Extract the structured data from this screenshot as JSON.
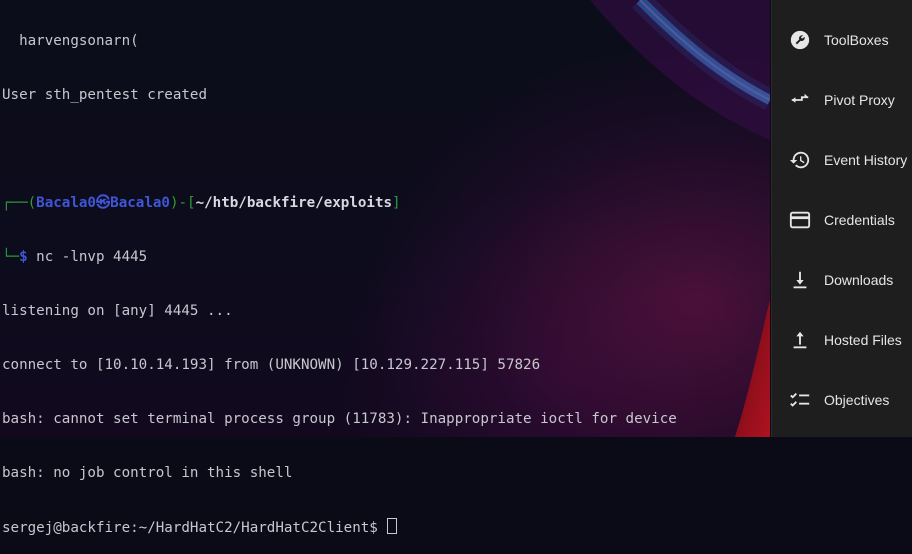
{
  "terminal": {
    "lines": [
      {
        "text": "  harvengsonarn("
      },
      {
        "text": "User sth_pentest created"
      },
      {
        "text": ""
      },
      {
        "prompt_open": "┌──(",
        "user": "Bacala0㉿Bacala0",
        "prompt_mid": ")-[",
        "path": "~/htb/backfire/exploits",
        "prompt_close": "]"
      },
      {
        "prompt_open": "└─",
        "dollar": "$",
        "command": " nc -lnvp 4445"
      },
      {
        "text": "listening on [any] 4445 ..."
      },
      {
        "text": "connect to [10.10.14.193] from (UNKNOWN) [10.129.227.115] 57826"
      },
      {
        "text": "bash: cannot set terminal process group (11783): Inappropriate ioctl for device"
      },
      {
        "text": "bash: no job control in this shell"
      },
      {
        "text": "sergej@backfire:~/HardHatC2/HardHatC2Client$ "
      }
    ]
  },
  "sidebar": {
    "items": [
      {
        "label": "ToolBoxes",
        "icon": "wrench-icon"
      },
      {
        "label": "Pivot Proxy",
        "icon": "pivot-arrows-icon"
      },
      {
        "label": "Event History",
        "icon": "history-icon"
      },
      {
        "label": "Credentials",
        "icon": "credit-card-icon"
      },
      {
        "label": "Downloads",
        "icon": "download-icon"
      },
      {
        "label": "Hosted Files",
        "icon": "upload-icon"
      },
      {
        "label": "Objectives",
        "icon": "checklist-icon"
      }
    ]
  },
  "colors": {
    "prompt_green": "#2f9b3a",
    "prompt_blue": "#3f56d6",
    "sidebar_bg": "#1e1e1e"
  }
}
